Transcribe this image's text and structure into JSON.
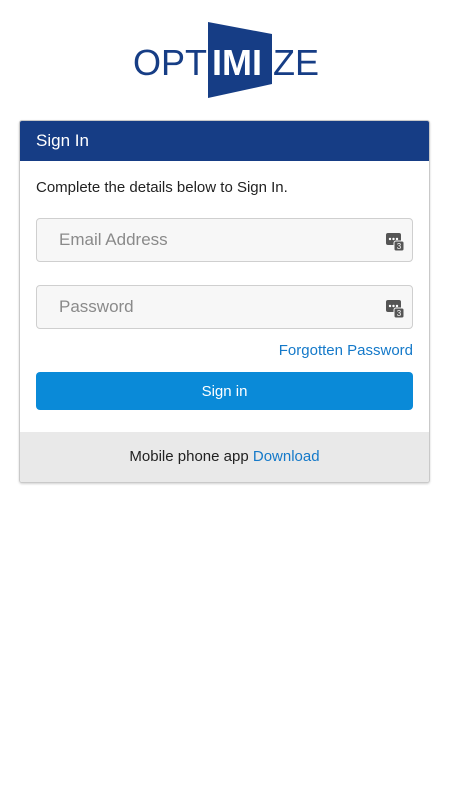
{
  "logo": {
    "text_left": "OPT",
    "text_mid": "IMI",
    "text_right": "ZE"
  },
  "card": {
    "header_title": "Sign In",
    "intro_text": "Complete the details below to Sign In.",
    "email_placeholder": "Email Address",
    "email_value": "",
    "password_placeholder": "Password",
    "password_value": "",
    "forgot_label": "Forgotten Password",
    "signin_label": "Sign in",
    "footer_text": "Mobile phone app",
    "footer_link": "Download"
  },
  "colors": {
    "header_bg": "#163d85",
    "button_bg": "#0a8ad8",
    "link": "#1479c9",
    "logo_blue": "#163d85",
    "footer_bg": "#e9e9e9"
  },
  "icons": {
    "field_keyboard": "keyboard-icon"
  }
}
